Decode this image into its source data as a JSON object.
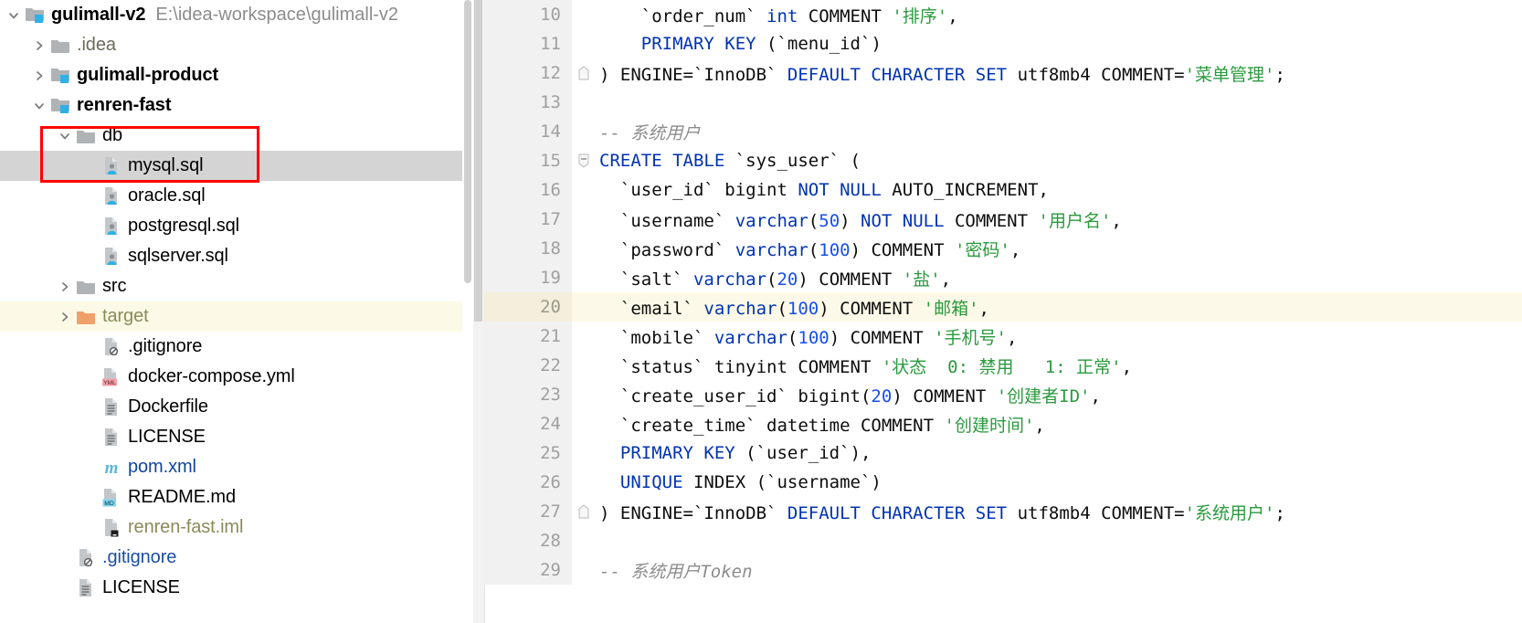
{
  "tree": {
    "items": [
      {
        "indent": 0,
        "arrow": "down",
        "icon": "module-folder",
        "label": "gulimall-v2",
        "bold": true,
        "note": "E:\\idea-workspace\\gulimall-v2",
        "state": "normal"
      },
      {
        "indent": 1,
        "arrow": "right",
        "icon": "folder-gray",
        "label": ".idea",
        "bold": false,
        "note": "",
        "state": "normal",
        "labelStyle": "muted"
      },
      {
        "indent": 1,
        "arrow": "right",
        "icon": "module-folder",
        "label": "gulimall-product",
        "bold": true,
        "note": "",
        "state": "normal"
      },
      {
        "indent": 1,
        "arrow": "down",
        "icon": "module-folder",
        "label": "renren-fast",
        "bold": true,
        "note": "",
        "state": "normal"
      },
      {
        "indent": 2,
        "arrow": "down",
        "icon": "folder-gray",
        "label": "db",
        "bold": false,
        "note": "",
        "state": "normal"
      },
      {
        "indent": 3,
        "arrow": "none",
        "icon": "sql-file",
        "label": "mysql.sql",
        "bold": false,
        "note": "",
        "state": "selected"
      },
      {
        "indent": 3,
        "arrow": "none",
        "icon": "sql-file",
        "label": "oracle.sql",
        "bold": false,
        "note": "",
        "state": "normal"
      },
      {
        "indent": 3,
        "arrow": "none",
        "icon": "sql-file",
        "label": "postgresql.sql",
        "bold": false,
        "note": "",
        "state": "normal"
      },
      {
        "indent": 3,
        "arrow": "none",
        "icon": "sql-file",
        "label": "sqlserver.sql",
        "bold": false,
        "note": "",
        "state": "normal"
      },
      {
        "indent": 2,
        "arrow": "right",
        "icon": "folder-gray",
        "label": "src",
        "bold": false,
        "note": "",
        "state": "normal"
      },
      {
        "indent": 2,
        "arrow": "right",
        "icon": "folder-orange",
        "label": "target",
        "bold": false,
        "note": "",
        "state": "excluded",
        "labelStyle": "excl"
      },
      {
        "indent": 3,
        "arrow": "none",
        "icon": "gitignore-file",
        "label": ".gitignore",
        "bold": false,
        "note": "",
        "state": "normal"
      },
      {
        "indent": 3,
        "arrow": "none",
        "icon": "yml-file",
        "label": "docker-compose.yml",
        "bold": false,
        "note": "",
        "state": "normal"
      },
      {
        "indent": 3,
        "arrow": "none",
        "icon": "text-file",
        "label": "Dockerfile",
        "bold": false,
        "note": "",
        "state": "normal"
      },
      {
        "indent": 3,
        "arrow": "none",
        "icon": "text-file",
        "label": "LICENSE",
        "bold": false,
        "note": "",
        "state": "normal"
      },
      {
        "indent": 3,
        "arrow": "none",
        "icon": "maven-m",
        "label": "pom.xml",
        "bold": false,
        "note": "",
        "state": "normal",
        "labelStyle": "blue"
      },
      {
        "indent": 3,
        "arrow": "none",
        "icon": "md-file",
        "label": "README.md",
        "bold": false,
        "note": "",
        "state": "normal"
      },
      {
        "indent": 3,
        "arrow": "none",
        "icon": "iml-file",
        "label": "renren-fast.iml",
        "bold": false,
        "note": "",
        "state": "normal",
        "labelStyle": "excl"
      },
      {
        "indent": 2,
        "arrow": "none",
        "icon": "gitignore-file",
        "label": ".gitignore",
        "bold": false,
        "note": "",
        "state": "normal",
        "labelStyle": "ignored"
      },
      {
        "indent": 2,
        "arrow": "none",
        "icon": "text-file",
        "label": "LICENSE",
        "bold": false,
        "note": "",
        "state": "normal"
      }
    ]
  },
  "editor": {
    "lines": [
      {
        "n": "10",
        "fold": "none",
        "tokens": [
          {
            "t": "    `order_num` ",
            "c": "plain"
          },
          {
            "t": "int",
            "c": "kw"
          },
          {
            "t": " COMMENT ",
            "c": "plain"
          },
          {
            "t": "'排序'",
            "c": "str"
          },
          {
            "t": ",",
            "c": "plain"
          }
        ]
      },
      {
        "n": "11",
        "fold": "none",
        "tokens": [
          {
            "t": "    ",
            "c": "plain"
          },
          {
            "t": "PRIMARY KEY",
            "c": "kw"
          },
          {
            "t": " (`menu_id`)",
            "c": "plain"
          }
        ]
      },
      {
        "n": "12",
        "fold": "end",
        "tokens": [
          {
            "t": ") ENGINE=`InnoDB` ",
            "c": "plain"
          },
          {
            "t": "DEFAULT CHARACTER SET",
            "c": "kw"
          },
          {
            "t": " utf8mb4 COMMENT=",
            "c": "plain"
          },
          {
            "t": "'菜单管理'",
            "c": "str"
          },
          {
            "t": ";",
            "c": "plain"
          }
        ]
      },
      {
        "n": "13",
        "fold": "none",
        "tokens": [
          {
            "t": "",
            "c": "plain"
          }
        ]
      },
      {
        "n": "14",
        "fold": "none",
        "tokens": [
          {
            "t": "-- 系统用户",
            "c": "cmt"
          }
        ]
      },
      {
        "n": "15",
        "fold": "start",
        "tokens": [
          {
            "t": "CREATE TABLE",
            "c": "kw"
          },
          {
            "t": " `sys_user` (",
            "c": "plain"
          }
        ]
      },
      {
        "n": "16",
        "fold": "none",
        "tokens": [
          {
            "t": "  `user_id` bigint ",
            "c": "plain"
          },
          {
            "t": "NOT NULL",
            "c": "kw"
          },
          {
            "t": " AUTO_INCREMENT,",
            "c": "plain"
          }
        ]
      },
      {
        "n": "17",
        "fold": "none",
        "tokens": [
          {
            "t": "  `username` ",
            "c": "plain"
          },
          {
            "t": "varchar",
            "c": "kw"
          },
          {
            "t": "(",
            "c": "plain"
          },
          {
            "t": "50",
            "c": "num"
          },
          {
            "t": ") ",
            "c": "plain"
          },
          {
            "t": "NOT NULL",
            "c": "kw"
          },
          {
            "t": " COMMENT ",
            "c": "plain"
          },
          {
            "t": "'用户名'",
            "c": "str"
          },
          {
            "t": ",",
            "c": "plain"
          }
        ]
      },
      {
        "n": "18",
        "fold": "none",
        "tokens": [
          {
            "t": "  `password` ",
            "c": "plain"
          },
          {
            "t": "varchar",
            "c": "kw"
          },
          {
            "t": "(",
            "c": "plain"
          },
          {
            "t": "100",
            "c": "num"
          },
          {
            "t": ") COMMENT ",
            "c": "plain"
          },
          {
            "t": "'密码'",
            "c": "str"
          },
          {
            "t": ",",
            "c": "plain"
          }
        ]
      },
      {
        "n": "19",
        "fold": "none",
        "tokens": [
          {
            "t": "  `salt` ",
            "c": "plain"
          },
          {
            "t": "varchar",
            "c": "kw"
          },
          {
            "t": "(",
            "c": "plain"
          },
          {
            "t": "20",
            "c": "num"
          },
          {
            "t": ") COMMENT ",
            "c": "plain"
          },
          {
            "t": "'盐'",
            "c": "str"
          },
          {
            "t": ",",
            "c": "plain"
          }
        ]
      },
      {
        "n": "20",
        "fold": "none",
        "current": true,
        "tokens": [
          {
            "t": "  `email` ",
            "c": "plain"
          },
          {
            "t": "varchar",
            "c": "kw"
          },
          {
            "t": "(",
            "c": "plain"
          },
          {
            "t": "100",
            "c": "num"
          },
          {
            "t": ") COMMENT ",
            "c": "plain"
          },
          {
            "t": "'邮箱'",
            "c": "str"
          },
          {
            "t": ",",
            "c": "plain"
          }
        ]
      },
      {
        "n": "21",
        "fold": "none",
        "tokens": [
          {
            "t": "  `mobile` ",
            "c": "plain"
          },
          {
            "t": "varchar",
            "c": "kw"
          },
          {
            "t": "(",
            "c": "plain"
          },
          {
            "t": "100",
            "c": "num"
          },
          {
            "t": ") COMMENT ",
            "c": "plain"
          },
          {
            "t": "'手机号'",
            "c": "str"
          },
          {
            "t": ",",
            "c": "plain"
          }
        ]
      },
      {
        "n": "22",
        "fold": "none",
        "tokens": [
          {
            "t": "  `status` tinyint COMMENT ",
            "c": "plain"
          },
          {
            "t": "'状态  0: 禁用   1: 正常'",
            "c": "str"
          },
          {
            "t": ",",
            "c": "plain"
          }
        ]
      },
      {
        "n": "23",
        "fold": "none",
        "tokens": [
          {
            "t": "  `create_user_id` bigint(",
            "c": "plain"
          },
          {
            "t": "20",
            "c": "num"
          },
          {
            "t": ") COMMENT ",
            "c": "plain"
          },
          {
            "t": "'创建者ID'",
            "c": "str"
          },
          {
            "t": ",",
            "c": "plain"
          }
        ]
      },
      {
        "n": "24",
        "fold": "none",
        "tokens": [
          {
            "t": "  `create_time` datetime COMMENT ",
            "c": "plain"
          },
          {
            "t": "'创建时间'",
            "c": "str"
          },
          {
            "t": ",",
            "c": "plain"
          }
        ]
      },
      {
        "n": "25",
        "fold": "none",
        "tokens": [
          {
            "t": "  ",
            "c": "plain"
          },
          {
            "t": "PRIMARY KEY",
            "c": "kw"
          },
          {
            "t": " (`user_id`),",
            "c": "plain"
          }
        ]
      },
      {
        "n": "26",
        "fold": "none",
        "tokens": [
          {
            "t": "  ",
            "c": "plain"
          },
          {
            "t": "UNIQUE",
            "c": "kw"
          },
          {
            "t": " INDEX (`username`)",
            "c": "plain"
          }
        ]
      },
      {
        "n": "27",
        "fold": "end",
        "tokens": [
          {
            "t": ") ENGINE=`InnoDB` ",
            "c": "plain"
          },
          {
            "t": "DEFAULT CHARACTER SET",
            "c": "kw"
          },
          {
            "t": " utf8mb4 COMMENT=",
            "c": "plain"
          },
          {
            "t": "'系统用户'",
            "c": "str"
          },
          {
            "t": ";",
            "c": "plain"
          }
        ]
      },
      {
        "n": "28",
        "fold": "none",
        "tokens": [
          {
            "t": "",
            "c": "plain"
          }
        ]
      },
      {
        "n": "29",
        "fold": "none",
        "tokens": [
          {
            "t": "-- 系统用户Token",
            "c": "cmt"
          }
        ]
      }
    ]
  },
  "colors": {
    "keyword": "#0033b3",
    "string": "#2a9a3e",
    "number": "#1750eb",
    "comment": "#8c8c8c",
    "selection": "#d4d4d4",
    "current_line": "#fdf9e8",
    "excluded_folder": "#fcfae6",
    "annotation": "#ff0000"
  }
}
